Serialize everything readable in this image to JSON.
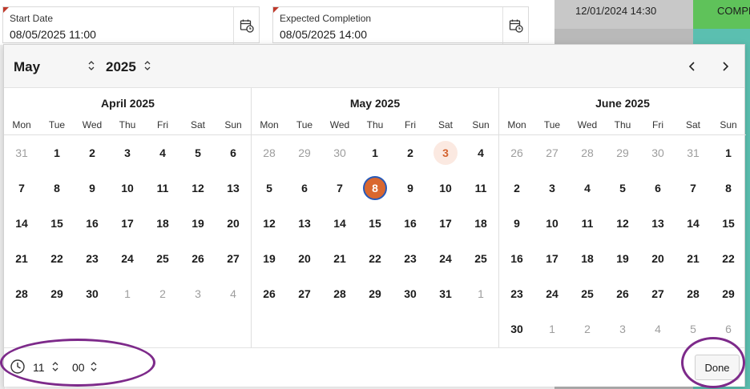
{
  "background": {
    "date_cell": "12/01/2024 14:30",
    "status_cell": "COMPL",
    "status_color": "#5fc25a",
    "teal_color": "#5bbfb0"
  },
  "fields": [
    {
      "label": "Start Date",
      "value": "08/05/2025 11:00"
    },
    {
      "label": "Expected Completion",
      "value": "08/05/2025 14:00"
    }
  ],
  "picker": {
    "month_select": "May",
    "year_select": "2025",
    "weekdays": [
      "Mon",
      "Tue",
      "Wed",
      "Thu",
      "Fri",
      "Sat",
      "Sun"
    ],
    "months": [
      {
        "title": "April 2025",
        "weeks": [
          [
            {
              "d": "31",
              "o": true
            },
            {
              "d": "1"
            },
            {
              "d": "2"
            },
            {
              "d": "3"
            },
            {
              "d": "4"
            },
            {
              "d": "5"
            },
            {
              "d": "6"
            }
          ],
          [
            {
              "d": "7"
            },
            {
              "d": "8"
            },
            {
              "d": "9"
            },
            {
              "d": "10"
            },
            {
              "d": "11"
            },
            {
              "d": "12"
            },
            {
              "d": "13"
            }
          ],
          [
            {
              "d": "14"
            },
            {
              "d": "15"
            },
            {
              "d": "16"
            },
            {
              "d": "17"
            },
            {
              "d": "18"
            },
            {
              "d": "19"
            },
            {
              "d": "20"
            }
          ],
          [
            {
              "d": "21"
            },
            {
              "d": "22"
            },
            {
              "d": "23"
            },
            {
              "d": "24"
            },
            {
              "d": "25"
            },
            {
              "d": "26"
            },
            {
              "d": "27"
            }
          ],
          [
            {
              "d": "28"
            },
            {
              "d": "29"
            },
            {
              "d": "30"
            },
            {
              "d": "1",
              "o": true
            },
            {
              "d": "2",
              "o": true
            },
            {
              "d": "3",
              "o": true
            },
            {
              "d": "4",
              "o": true
            }
          ]
        ]
      },
      {
        "title": "May 2025",
        "weeks": [
          [
            {
              "d": "28",
              "o": true
            },
            {
              "d": "29",
              "o": true
            },
            {
              "d": "30",
              "o": true
            },
            {
              "d": "1"
            },
            {
              "d": "2"
            },
            {
              "d": "3",
              "today": true
            },
            {
              "d": "4"
            }
          ],
          [
            {
              "d": "5"
            },
            {
              "d": "6"
            },
            {
              "d": "7"
            },
            {
              "d": "8",
              "sel": true
            },
            {
              "d": "9"
            },
            {
              "d": "10"
            },
            {
              "d": "11"
            }
          ],
          [
            {
              "d": "12"
            },
            {
              "d": "13"
            },
            {
              "d": "14"
            },
            {
              "d": "15"
            },
            {
              "d": "16"
            },
            {
              "d": "17"
            },
            {
              "d": "18"
            }
          ],
          [
            {
              "d": "19"
            },
            {
              "d": "20"
            },
            {
              "d": "21"
            },
            {
              "d": "22"
            },
            {
              "d": "23"
            },
            {
              "d": "24"
            },
            {
              "d": "25"
            }
          ],
          [
            {
              "d": "26"
            },
            {
              "d": "27"
            },
            {
              "d": "28"
            },
            {
              "d": "29"
            },
            {
              "d": "30"
            },
            {
              "d": "31"
            },
            {
              "d": "1",
              "o": true
            }
          ]
        ]
      },
      {
        "title": "June 2025",
        "weeks": [
          [
            {
              "d": "26",
              "o": true
            },
            {
              "d": "27",
              "o": true
            },
            {
              "d": "28",
              "o": true
            },
            {
              "d": "29",
              "o": true
            },
            {
              "d": "30",
              "o": true
            },
            {
              "d": "31",
              "o": true
            },
            {
              "d": "1"
            }
          ],
          [
            {
              "d": "2"
            },
            {
              "d": "3"
            },
            {
              "d": "4"
            },
            {
              "d": "5"
            },
            {
              "d": "6"
            },
            {
              "d": "7"
            },
            {
              "d": "8"
            }
          ],
          [
            {
              "d": "9"
            },
            {
              "d": "10"
            },
            {
              "d": "11"
            },
            {
              "d": "12"
            },
            {
              "d": "13"
            },
            {
              "d": "14"
            },
            {
              "d": "15"
            }
          ],
          [
            {
              "d": "16"
            },
            {
              "d": "17"
            },
            {
              "d": "18"
            },
            {
              "d": "19"
            },
            {
              "d": "20"
            },
            {
              "d": "21"
            },
            {
              "d": "22"
            }
          ],
          [
            {
              "d": "23"
            },
            {
              "d": "24"
            },
            {
              "d": "25"
            },
            {
              "d": "26"
            },
            {
              "d": "27"
            },
            {
              "d": "28"
            },
            {
              "d": "29"
            }
          ],
          [
            {
              "d": "30"
            },
            {
              "d": "1",
              "o": true
            },
            {
              "d": "2",
              "o": true
            },
            {
              "d": "3",
              "o": true
            },
            {
              "d": "4",
              "o": true
            },
            {
              "d": "5",
              "o": true
            },
            {
              "d": "6",
              "o": true
            }
          ]
        ]
      }
    ],
    "time": {
      "hour": "11",
      "minute": "00"
    },
    "done_label": "Done",
    "accent_color": "#d9672f",
    "annotation_color": "#7d2a8a"
  }
}
